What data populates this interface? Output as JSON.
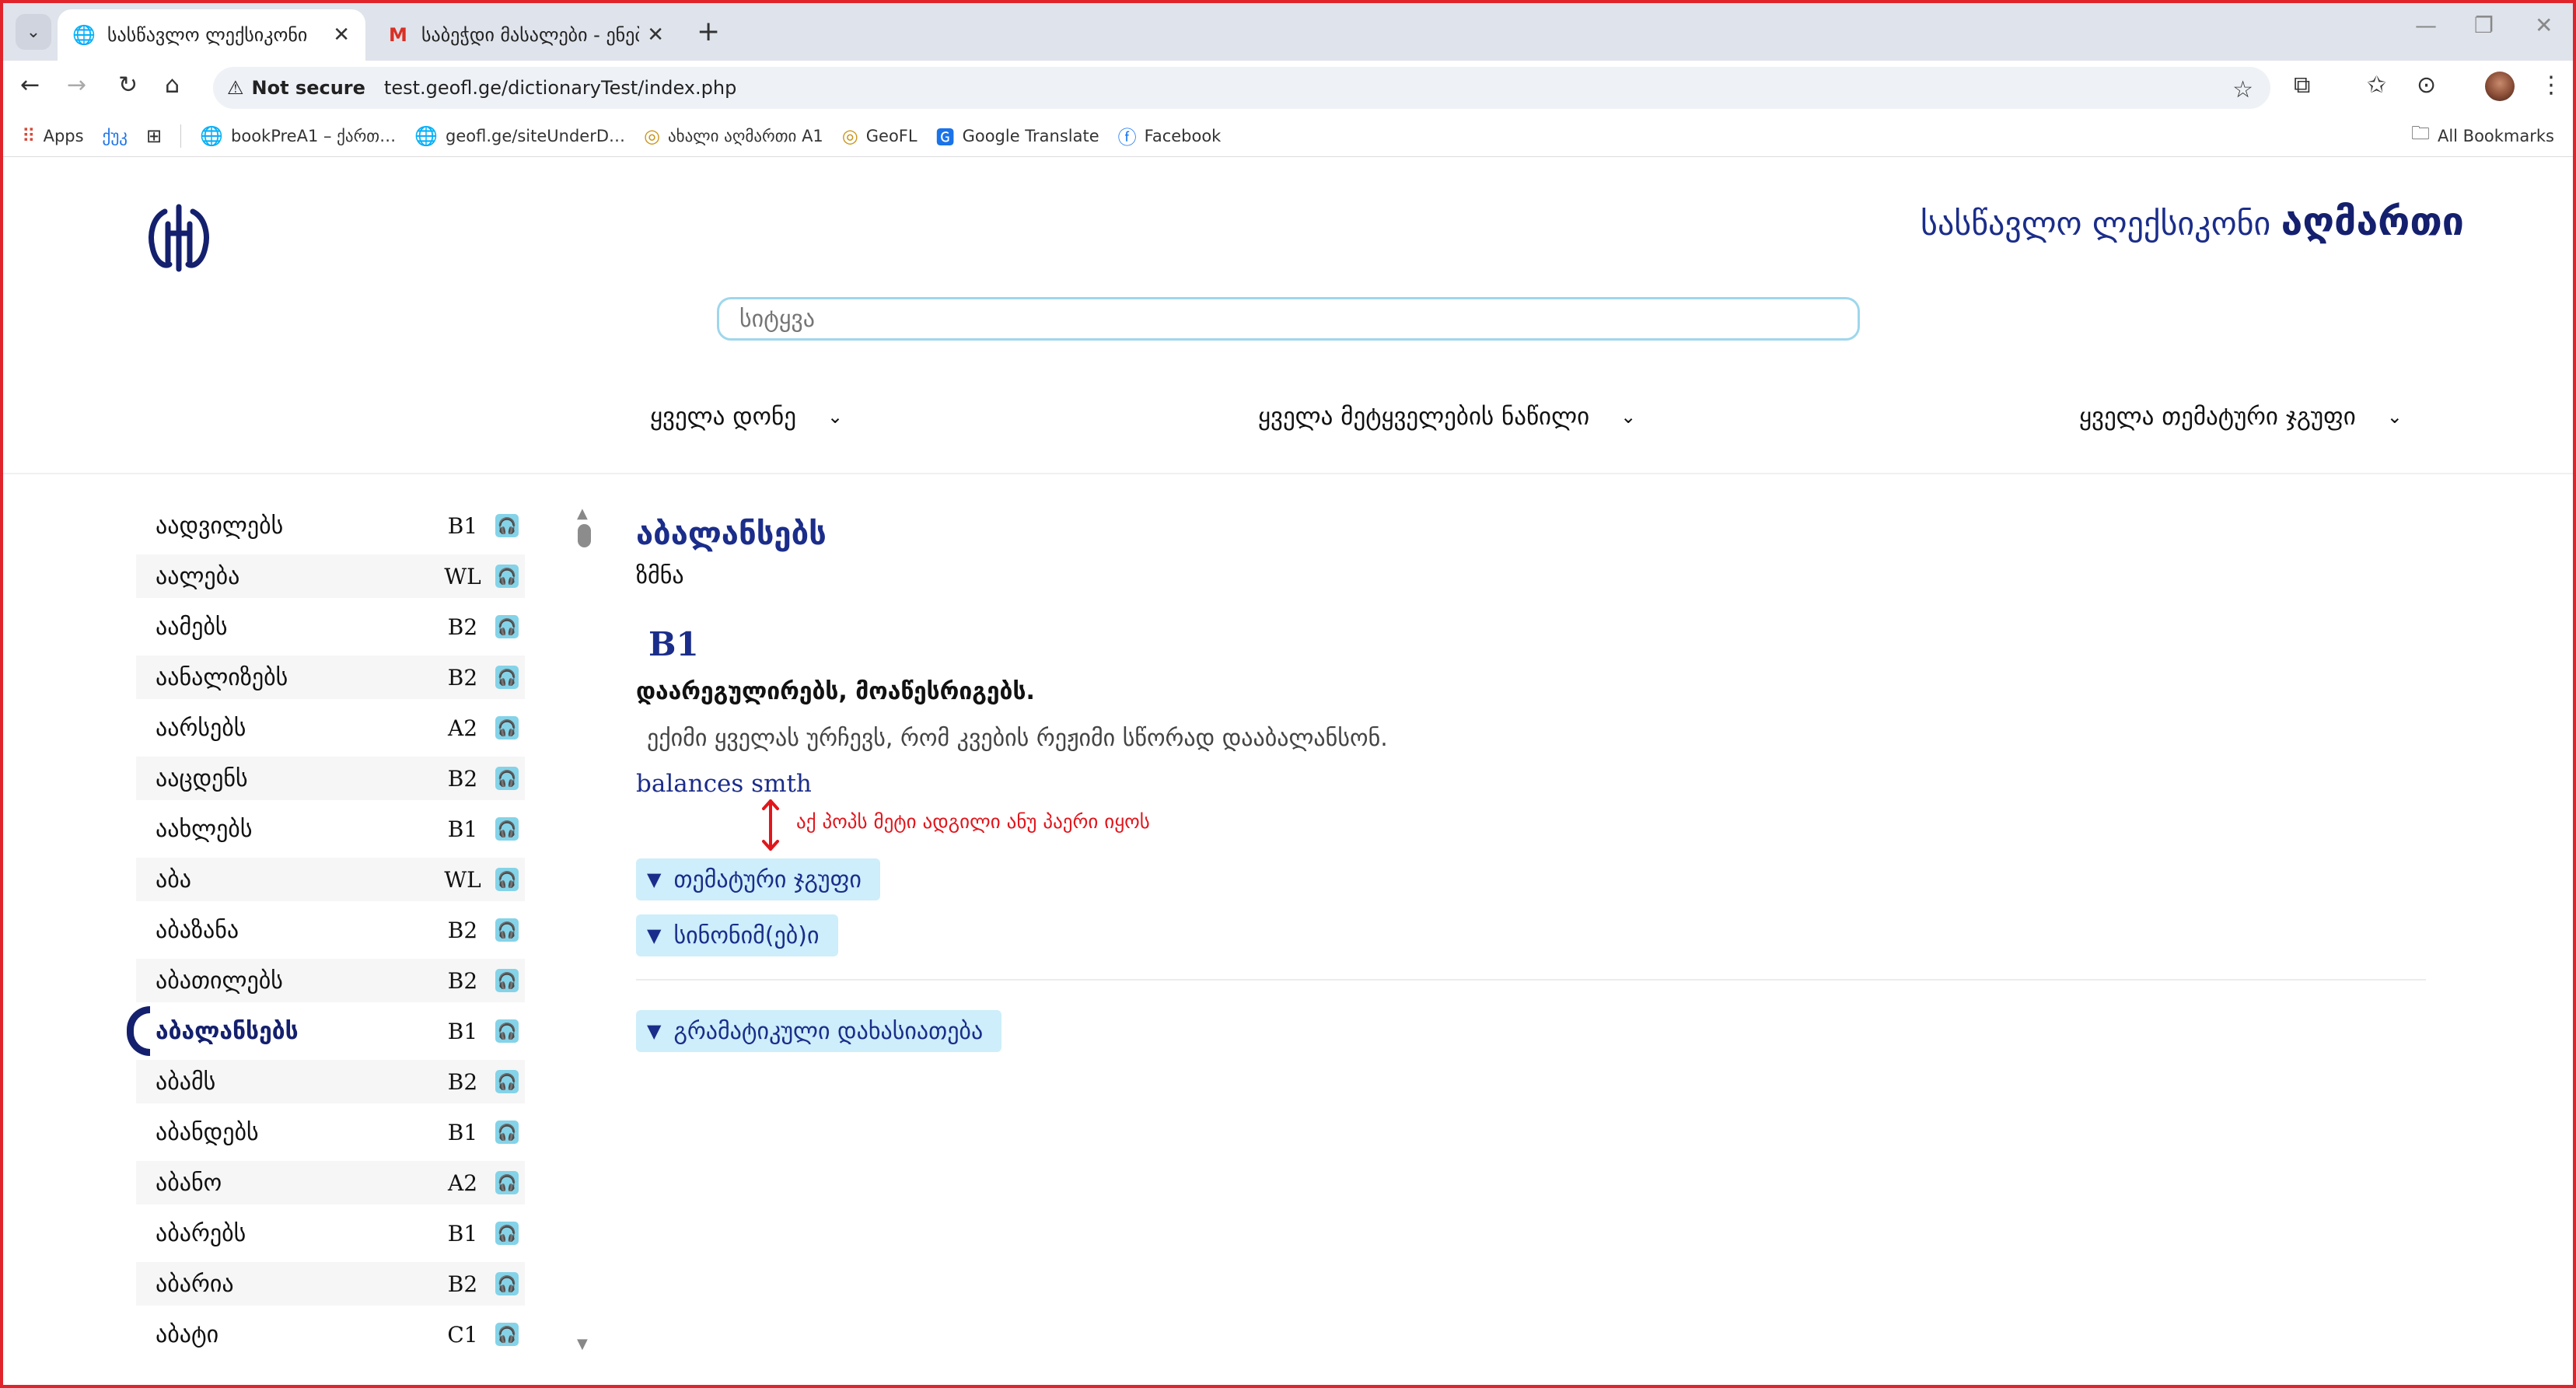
{
  "browser": {
    "tabs": [
      {
        "title": "სასწავლო ლექსიკონი",
        "active": true
      },
      {
        "title": "საბეჭდი მასალები - ენებ…",
        "active": false
      }
    ],
    "url_security": "Not secure",
    "url": "test.geofl.ge/dictionaryTest/index.php",
    "bookmarks": [
      {
        "label": "Apps",
        "icon": "apps-grid-icon"
      },
      {
        "label": "ქუკ",
        "icon": "none"
      },
      {
        "label": "",
        "icon": "grid-icon"
      },
      {
        "label": "bookPreA1 – ქართ…",
        "icon": "globe-icon"
      },
      {
        "label": "geofl.ge/siteUnderD…",
        "icon": "globe-icon"
      },
      {
        "label": "ახალი აღმართი A1",
        "icon": "site-icon"
      },
      {
        "label": "GeoFL",
        "icon": "site-icon"
      },
      {
        "label": "Google Translate",
        "icon": "translate-icon"
      },
      {
        "label": "Facebook",
        "icon": "facebook-icon"
      }
    ],
    "all_bookmarks": "All Bookmarks"
  },
  "header": {
    "title_regular": "სასწავლო ლექსიკონი",
    "title_bold": "აღმართი",
    "search_placeholder": "სიტყვა"
  },
  "filters": {
    "level": "ყველა დონე",
    "pos": "ყველა მეტყველების ნაწილი",
    "theme": "ყველა თემატური ჯგუფი"
  },
  "word_list": [
    {
      "word": "აადვილებს",
      "level": "B1"
    },
    {
      "word": "აალება",
      "level": "WL"
    },
    {
      "word": "აამებს",
      "level": "B2"
    },
    {
      "word": "აანალიზებს",
      "level": "B2"
    },
    {
      "word": "აარსებს",
      "level": "A2"
    },
    {
      "word": "ააცდენს",
      "level": "B2"
    },
    {
      "word": "აახლებს",
      "level": "B1"
    },
    {
      "word": "აბა",
      "level": "WL"
    },
    {
      "word": "აბაზანა",
      "level": "B2"
    },
    {
      "word": "აბათილებს",
      "level": "B2"
    },
    {
      "word": "აბალანსებს",
      "level": "B1",
      "selected": true
    },
    {
      "word": "აბამს",
      "level": "B2"
    },
    {
      "word": "აბანდებს",
      "level": "B1"
    },
    {
      "word": "აბანო",
      "level": "A2"
    },
    {
      "word": "აბარებს",
      "level": "B1"
    },
    {
      "word": "აბარია",
      "level": "B2"
    },
    {
      "word": "აბატი",
      "level": "C1"
    }
  ],
  "entry": {
    "headword": "აბალანსებს",
    "pos": "ზმნა",
    "level": "B1",
    "definition": "დაარეგულირებს, მოაწესრიგებს.",
    "example": "ექიმი ყველას ურჩევს, რომ კვების რეჟიმი სწორად დააბალანსონ.",
    "translation": "balances smth",
    "note": "აქ პოპს მეტი ადგილი ანუ პაერი იყოს",
    "sections": [
      "თემატური ჯგუფი",
      "სინონიმ(ებ)ი",
      "გრამატიკული დახასიათება"
    ]
  },
  "colors": {
    "brand": "#1b2d8a",
    "accent": "#84d3e8",
    "accordion": "#cdeefa",
    "annotation": "#e1161c"
  }
}
